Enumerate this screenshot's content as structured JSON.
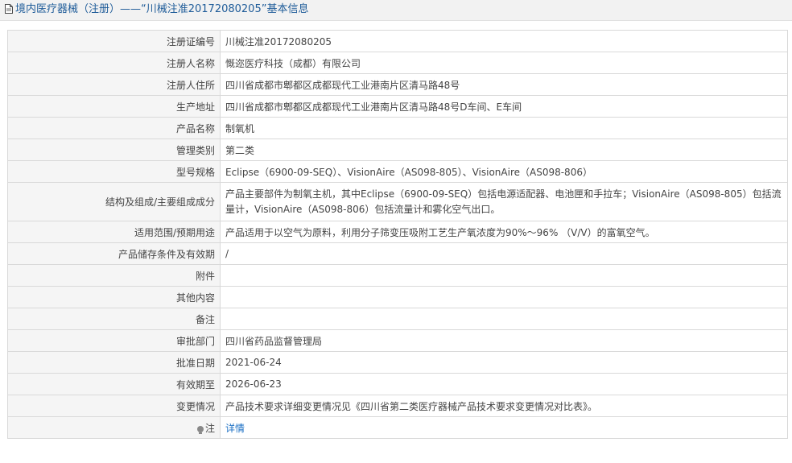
{
  "header": {
    "title": "境内医疗器械（注册）——“川械注准20172080205”基本信息"
  },
  "rows": [
    {
      "label": "注册证编号",
      "value": "川械注准20172080205"
    },
    {
      "label": "注册人名称",
      "value": "慨迩医疗科技（成都）有限公司"
    },
    {
      "label": "注册人住所",
      "value": "四川省成都市郫都区成都现代工业港南片区清马路48号"
    },
    {
      "label": "生产地址",
      "value": "四川省成都市郫都区成都现代工业港南片区清马路48号D车间、E车间"
    },
    {
      "label": "产品名称",
      "value": "制氧机"
    },
    {
      "label": "管理类别",
      "value": "第二类"
    },
    {
      "label": "型号规格",
      "value": "Eclipse（6900-09-SEQ）、VisionAire（AS098-805）、VisionAire（AS098-806）"
    },
    {
      "label": "结构及组成/主要组成成分",
      "value": "产品主要部件为制氧主机，其中Eclipse（6900-09-SEQ）包括电源适配器、电池匣和手拉车；VisionAire（AS098-805）包括流量计，VisionAire（AS098-806）包括流量计和雾化空气出口。"
    },
    {
      "label": "适用范围/预期用途",
      "value": "产品适用于以空气为原料，利用分子筛变压吸附工艺生产氧浓度为90%～96% （V/V）的富氧空气。"
    },
    {
      "label": "产品储存条件及有效期",
      "value": "/"
    },
    {
      "label": "附件",
      "value": ""
    },
    {
      "label": "其他内容",
      "value": ""
    },
    {
      "label": "备注",
      "value": ""
    },
    {
      "label": "审批部门",
      "value": "四川省药品监督管理局"
    },
    {
      "label": "批准日期",
      "value": "2021-06-24"
    },
    {
      "label": "有效期至",
      "value": "2026-06-23"
    },
    {
      "label": "变更情况",
      "value": "产品技术要求详细变更情况见《四川省第二类医疗器械产品技术要求变更情况对比表》。"
    }
  ],
  "note": {
    "label": "注",
    "link_text": "详情",
    "icon": "lightbulb-icon"
  },
  "colors": {
    "title_text": "#1f5c99",
    "link": "#1a6fc4",
    "label_bg": "#f5f5f5",
    "border": "#d9d9d9"
  }
}
